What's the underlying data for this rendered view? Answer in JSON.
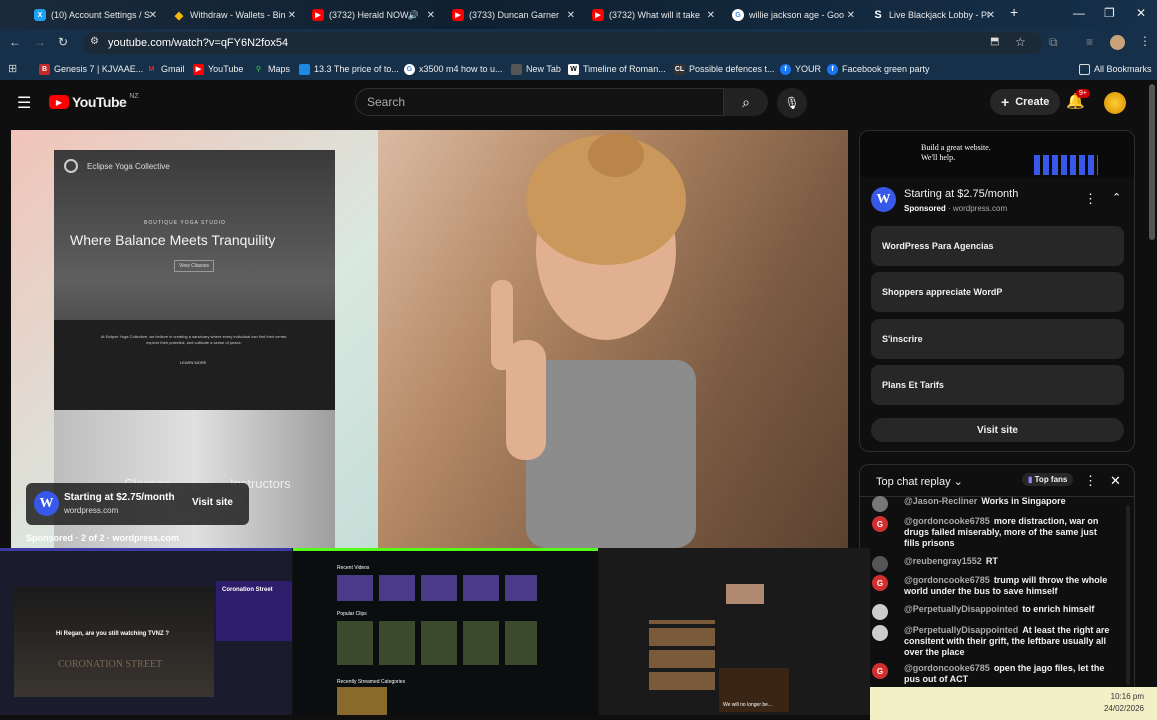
{
  "browser": {
    "tabs": [
      {
        "title": "(10) Account Settings / S",
        "icon": "settings-tab-icon",
        "color": "#1da1f2"
      },
      {
        "title": "Withdraw - Wallets - Bin",
        "icon": "binance-icon",
        "color": "#f0b90b"
      },
      {
        "title": "(3732) Herald NOW",
        "icon": "youtube-icon",
        "color": "#ff0000"
      },
      {
        "title": "(3733) Duncan Garner",
        "icon": "youtube-icon",
        "color": "#ff0000"
      },
      {
        "title": "(3732) What will it take",
        "icon": "youtube-icon",
        "color": "#ff0000"
      },
      {
        "title": "willie jackson age - Goo",
        "icon": "google-icon",
        "color": "#4285f4"
      },
      {
        "title": "Live Blackjack Lobby - Pl",
        "icon": "stake-icon",
        "color": "#1c2b39"
      }
    ],
    "url": "youtube.com/watch?v=qFY6N2fox54",
    "bookmarks": [
      {
        "label": "Genesis 7 | KJVAAE...",
        "color": "#c62828"
      },
      {
        "label": "Gmail",
        "color": "#d93025"
      },
      {
        "label": "YouTube",
        "color": "#ff0000"
      },
      {
        "label": "Maps",
        "color": "#34a853"
      },
      {
        "label": "13.3 The price of to...",
        "color": "#1e88e5"
      },
      {
        "label": "x3500 m4 how to u...",
        "color": "#4285f4"
      },
      {
        "label": "New Tab",
        "color": "#555555"
      },
      {
        "label": "Timeline of Roman...",
        "color": "#ffffff"
      },
      {
        "label": "Possible defences t...",
        "color": "#333333"
      },
      {
        "label": "YOUR",
        "color": "#1877f2"
      },
      {
        "label": "Facebook green party",
        "color": "#1877f2"
      }
    ],
    "all_bookmarks": "All Bookmarks"
  },
  "youtube": {
    "logo_text": "YouTube",
    "region": "NZ",
    "search_placeholder": "Search",
    "create_label": "Create",
    "notif_count": "9+"
  },
  "video": {
    "yoga_brand": "Eclipse Yoga Collective",
    "yoga_kicker": "BOUTIQUE YOGA STUDIO",
    "yoga_headline": "Where Balance Meets Tranquility",
    "yoga_cta": "View Classes",
    "yoga_blurb": "At Eclipse Yoga Collective, we believe in creating a sanctuary where every individual can find their center, explore their potential, and cultivate a sense of peace.",
    "yoga_learn": "LEARN MORE",
    "yoga_classes": "Classes",
    "yoga_instructors": "Instructors",
    "ad_title": "Starting at $2.75/month",
    "ad_domain": "wordpress.com",
    "ad_visit": "Visit site",
    "sponsored_line": "Sponsored · 2 of 2 · wordpress.com"
  },
  "ad_panel": {
    "banner_line1": "Build a great website.",
    "banner_line2": "We'll help.",
    "title": "Starting at $2.75/month",
    "sponsored": "Sponsored",
    "domain": "wordpress.com",
    "links": [
      "WordPress Para Agencias",
      "Shoppers appreciate WordP",
      "S'inscrire",
      "Plans Et Tarifs"
    ],
    "visit": "Visit site"
  },
  "chat": {
    "header": "Top chat replay",
    "top_fans": "Top fans",
    "messages": [
      {
        "author": "@Jason-Recliner",
        "text": "Works in Singapore",
        "avatar_color": "#777777",
        "avatar_letter": ""
      },
      {
        "author": "@gordoncooke6785",
        "text": "more distraction, war on drugs failed miserably, more of the same just fills prisons",
        "avatar_color": "#d32f2f",
        "avatar_letter": "G"
      },
      {
        "author": "@reubengray1552",
        "text": "RT",
        "avatar_color": "#555555",
        "avatar_letter": ""
      },
      {
        "author": "@gordoncooke6785",
        "text": "trump will throw the whole world under the bus to save himself",
        "avatar_color": "#d32f2f",
        "avatar_letter": "G"
      },
      {
        "author": "@PerpetuallyDisappointed",
        "text": "to enrich himself",
        "avatar_color": "#cccccc",
        "avatar_letter": ""
      },
      {
        "author": "@PerpetuallyDisappointed",
        "text": "At least the right are consitent with their grift, the leftbare usually all over the place",
        "avatar_color": "#cccccc",
        "avatar_letter": ""
      },
      {
        "author": "@gordoncooke6785",
        "text": "open the jago files, let the pus out of ACT",
        "avatar_color": "#d32f2f",
        "avatar_letter": "G"
      }
    ]
  },
  "thumbnails": {
    "first_text1": "Hi Regan, are you still watching TVNZ ?",
    "first_text2": "CORONATION STREET",
    "first_title": "Coronation Street",
    "second_sec1": "Recent Videos",
    "second_sec2": "Popular Clips",
    "second_sec3": "Recently Streamed Categories",
    "third_text": "We will no longer be..."
  },
  "system": {
    "time": "10:16 pm",
    "date": "24/02/2026"
  }
}
